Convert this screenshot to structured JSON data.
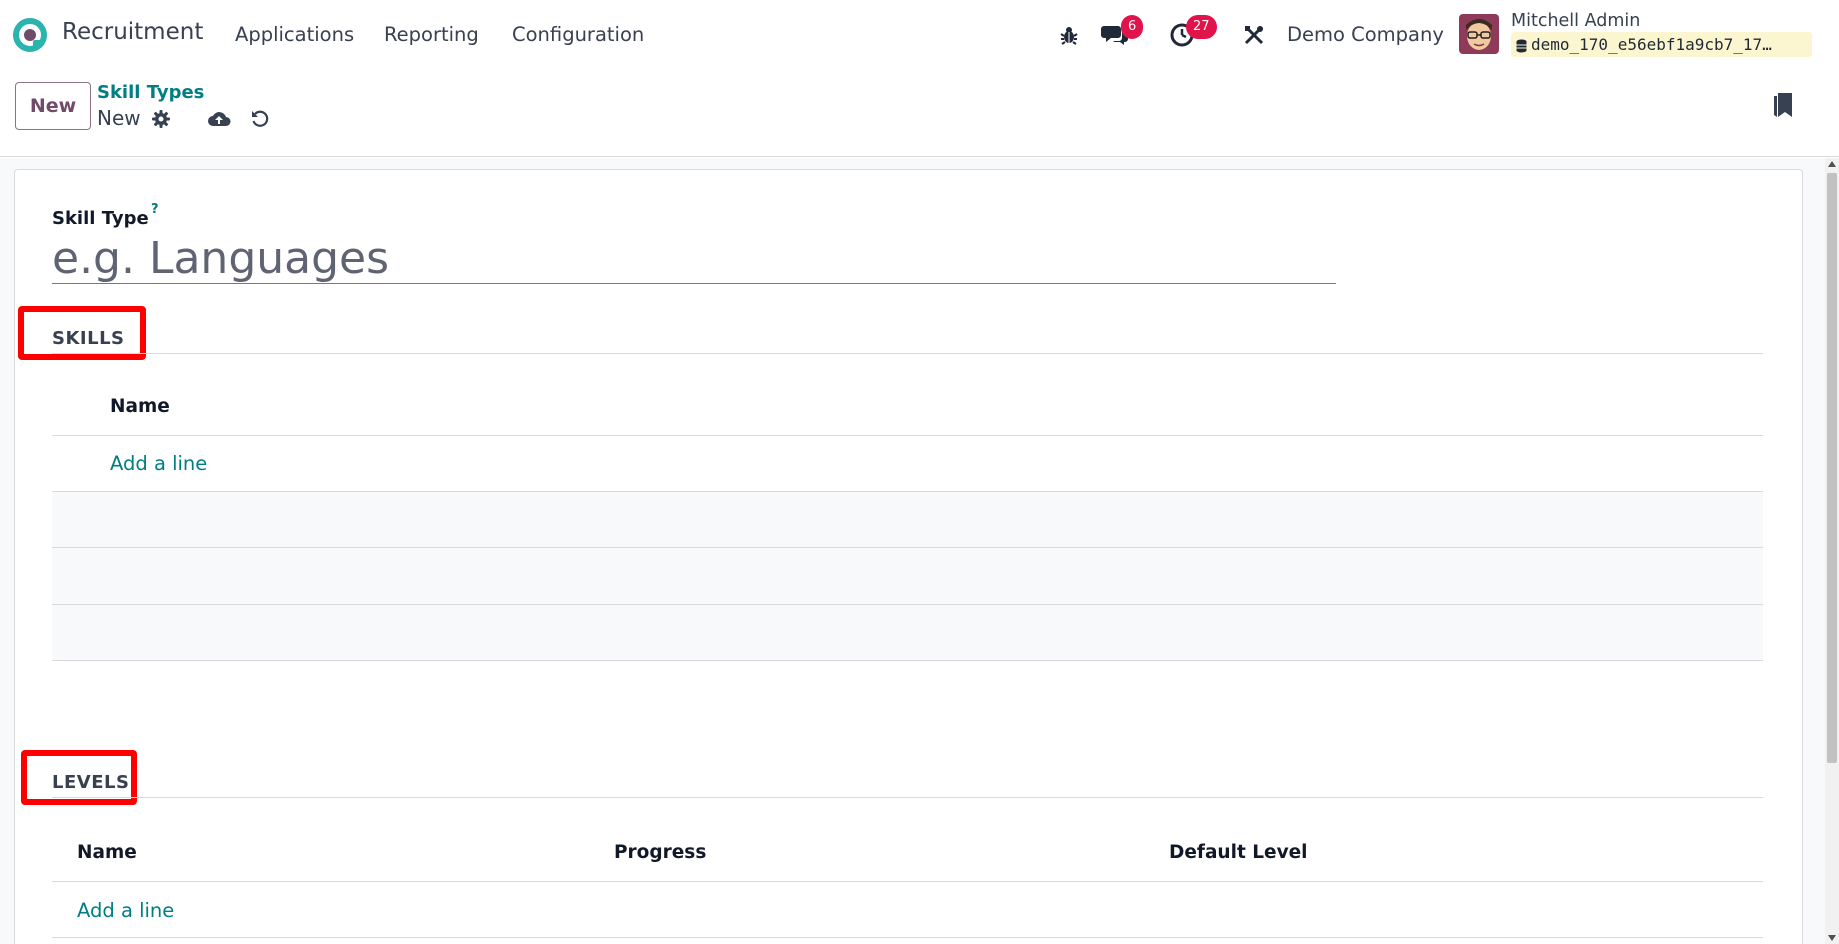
{
  "navbar": {
    "app_name": "Recruitment",
    "menu": [
      "Applications",
      "Reporting",
      "Configuration"
    ],
    "messages_count": "6",
    "activities_count": "27",
    "company": "Demo Company",
    "user_name": "Mitchell Admin",
    "database": "demo_170_e56ebf1a9cb7_17…",
    "icons": {
      "logo": "odoo-logo-icon",
      "debug": "bug-icon",
      "messages": "chat-icon",
      "activities": "clock-icon",
      "settings": "tools-icon",
      "database": "database-icon"
    }
  },
  "control_panel": {
    "new_button": "New",
    "breadcrumb_parent": "Skill Types",
    "breadcrumb_current": "New",
    "icons": {
      "actions": "gear-icon",
      "save": "cloud-upload-icon",
      "discard": "undo-icon",
      "bookmark": "bookmark-icon"
    }
  },
  "form": {
    "skill_type_label": "Skill Type",
    "help_mark": "?",
    "skill_type_placeholder": "e.g. Languages",
    "skill_type_value": "",
    "skills_section": {
      "title": "SKILLS",
      "columns": [
        "Name"
      ],
      "add_line": "Add a line",
      "rows": []
    },
    "levels_section": {
      "title": "LEVELS",
      "columns": [
        "Name",
        "Progress",
        "Default Level"
      ],
      "add_line": "Add a line",
      "rows": []
    }
  },
  "colors": {
    "brand_purple": "#714b67",
    "teal_link": "#017e84",
    "badge_red": "#e0134a",
    "highlight_red": "#ff0000"
  }
}
